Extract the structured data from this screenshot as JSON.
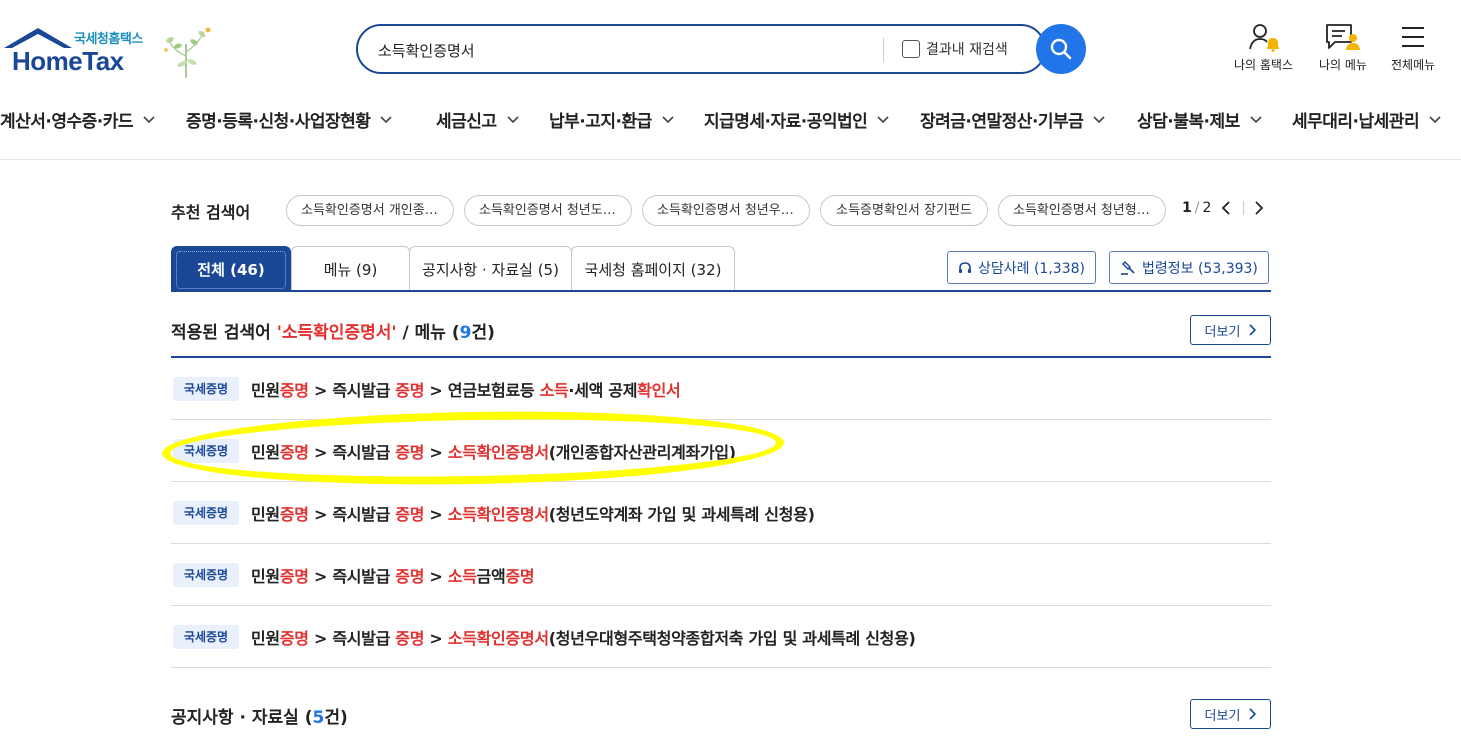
{
  "header": {
    "logo_sub": "국세청홈택스",
    "logo_main": "HomeTax",
    "search_value": "소득확인증명서",
    "recheck_label": "결과내 재검색",
    "util": [
      {
        "label": "나의 홈택스",
        "icon": "person-bell-icon"
      },
      {
        "label": "나의 메뉴",
        "icon": "my-menu-icon"
      },
      {
        "label": "전체메뉴",
        "icon": "hamburger-icon"
      }
    ]
  },
  "gnb": [
    "계산서·영수증·카드",
    "증명·등록·신청·사업장현황",
    "세금신고",
    "납부·고지·환급",
    "지급명세·자료·공익법인",
    "장려금·연말정산·기부금",
    "상담·불복·제보",
    "세무대리·납세관리"
  ],
  "recommend": {
    "label": "추천 검색어",
    "chips": [
      "소득확인증명서 개인종합자산관리계좌",
      "소득확인증명서 청년도약계좌",
      "소득확인증명서 청년우대형주택청약",
      "소득증명확인서 장기펀드",
      "소득확인증명서 청년형장기펀드"
    ],
    "page_current": "1",
    "page_total": "2"
  },
  "tabs": [
    {
      "label": "전체 (46)",
      "active": true
    },
    {
      "label": "메뉴 (9)",
      "active": false
    },
    {
      "label": "공지사항 · 자료실 (5)",
      "active": false
    },
    {
      "label": "국세청 홈페이지 (32)",
      "active": false
    }
  ],
  "side_buttons": {
    "consult": "상담사례 (1,338)",
    "law": "법령정보 (53,393)"
  },
  "section_menu": {
    "prefix": "적용된 검색어 ",
    "term": "'소득확인증명서'",
    "mid": " / 메뉴 (",
    "count": "9",
    "suffix": "건)",
    "more": "더보기"
  },
  "results": [
    {
      "badge": "국세증명",
      "parts": [
        [
          "민원",
          ""
        ],
        [
          "증명",
          "red"
        ],
        [
          " > 즉시발급 ",
          ""
        ],
        [
          "증명",
          "red"
        ],
        [
          " > 연금보험료등 ",
          ""
        ],
        [
          "소득",
          "red"
        ],
        [
          "·세액 공제",
          ""
        ],
        [
          "확인서",
          "red"
        ]
      ]
    },
    {
      "badge": "국세증명",
      "parts": [
        [
          "민원",
          ""
        ],
        [
          "증명",
          "red"
        ],
        [
          " > 즉시발급 ",
          ""
        ],
        [
          "증명",
          "red"
        ],
        [
          " > ",
          ""
        ],
        [
          "소득확인증명서",
          "red"
        ],
        [
          "(개인종합자산관리계좌가입)",
          ""
        ]
      ]
    },
    {
      "badge": "국세증명",
      "parts": [
        [
          "민원",
          ""
        ],
        [
          "증명",
          "red"
        ],
        [
          " > 즉시발급 ",
          ""
        ],
        [
          "증명",
          "red"
        ],
        [
          " > ",
          ""
        ],
        [
          "소득확인증명서",
          "red"
        ],
        [
          "(청년도약계좌 가입 및 과세특례 신청용)",
          ""
        ]
      ]
    },
    {
      "badge": "국세증명",
      "parts": [
        [
          "민원",
          ""
        ],
        [
          "증명",
          "red"
        ],
        [
          " > 즉시발급 ",
          ""
        ],
        [
          "증명",
          "red"
        ],
        [
          " > ",
          ""
        ],
        [
          "소득",
          "red"
        ],
        [
          "금액",
          ""
        ],
        [
          "증명",
          "red"
        ]
      ]
    },
    {
      "badge": "국세증명",
      "parts": [
        [
          "민원",
          ""
        ],
        [
          "증명",
          "red"
        ],
        [
          " > 즉시발급 ",
          ""
        ],
        [
          "증명",
          "red"
        ],
        [
          " > ",
          ""
        ],
        [
          "소득확인증명서",
          "red"
        ],
        [
          "(청년우대형주택청약종합저축 가입 및 과세특례 신청용)",
          ""
        ]
      ]
    }
  ],
  "section_notice": {
    "prefix": "공지사항 · 자료실 (",
    "count": "5",
    "suffix": "건)",
    "more": "더보기"
  },
  "colors": {
    "brand": "#1a4796",
    "accent": "#2175e8",
    "highlight_red": "#e2322f",
    "annotation": "#ffff00"
  }
}
